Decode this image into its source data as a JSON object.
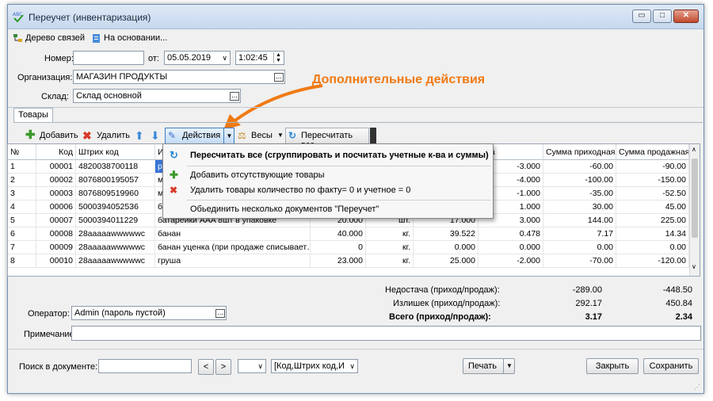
{
  "window": {
    "title": "Переучет (инвентаризация)",
    "minimize": "▭",
    "maximize": "□",
    "close": "✕"
  },
  "links": {
    "tree": "Дерево связей",
    "based_on": "На основании..."
  },
  "header": {
    "number_label": "Номер:",
    "number_value": "",
    "date_label": "от:",
    "date_value": "05.05.2019",
    "time_value": "1:02:45",
    "org_label": "Организация:",
    "org_value": "МАГАЗИН ПРОДУКТЫ",
    "warehouse_label": "Склад:",
    "warehouse_value": "Склад основной"
  },
  "annotation": {
    "text": "Дополнительные действия",
    "color": "#f07a14"
  },
  "tabs": {
    "goods": "Товары"
  },
  "toolbar": {
    "add": "Добавить",
    "delete": "Удалить",
    "actions": "Действия",
    "scales": "Весы",
    "recalc": "Пересчитать все"
  },
  "grid": {
    "columns": [
      "№",
      "Код",
      "Штрих код",
      "Ин",
      "ица",
      "Сумма приходная",
      "Сумма продажная"
    ],
    "rows": [
      {
        "n": "1",
        "code": "00001",
        "barcode": "4820038700118",
        "name": "рис",
        "qty_fact": "",
        "unit": "",
        "price": "",
        "diff": "-3.000",
        "sum_in": "-60.00",
        "sum_sale": "-90.00"
      },
      {
        "n": "2",
        "code": "00002",
        "barcode": "8076800195057",
        "name": "ма",
        "qty_fact": "",
        "unit": "",
        "price": "",
        "diff": "-4.000",
        "sum_in": "-100.00",
        "sum_sale": "-150.00"
      },
      {
        "n": "3",
        "code": "00003",
        "barcode": "8076809519960",
        "name": "ма",
        "qty_fact": "",
        "unit": "",
        "price": "",
        "diff": "-1.000",
        "sum_in": "-35.00",
        "sum_sale": "-52.50"
      },
      {
        "n": "4",
        "code": "00006",
        "barcode": "5000394052536",
        "name": "бат",
        "qty_fact": "",
        "unit": "",
        "price": "",
        "diff": "1.000",
        "sum_in": "30.00",
        "sum_sale": "45.00"
      },
      {
        "n": "5",
        "code": "00007",
        "barcode": "5000394011229",
        "name": "батарейки AAA 8шт в упаковке",
        "qty_fact": "20.000",
        "unit": "шт.",
        "price": "17.000",
        "diff": "3.000",
        "sum_in": "144.00",
        "sum_sale": "225.00"
      },
      {
        "n": "6",
        "code": "00008",
        "barcode": "28aaaaawwwwwc",
        "name": "банан",
        "qty_fact": "40.000",
        "unit": "кг.",
        "price": "39.522",
        "diff": "0.478",
        "sum_in": "7.17",
        "sum_sale": "14.34"
      },
      {
        "n": "7",
        "code": "00009",
        "barcode": "28aaaaawwwwwc",
        "name": "банан уценка (при продаже списывает…",
        "qty_fact": "0",
        "unit": "кг.",
        "price": "0.000",
        "diff": "0.000",
        "sum_in": "0.00",
        "sum_sale": "0.00"
      },
      {
        "n": "8",
        "code": "00010",
        "barcode": "28aaaaawwwwwc",
        "name": "груша",
        "qty_fact": "23.000",
        "unit": "кг.",
        "price": "25.000",
        "diff": "-2.000",
        "sum_in": "-70.00",
        "sum_sale": "-120.00"
      }
    ]
  },
  "menu": {
    "items": [
      "Пересчитать все (сгруппировать и посчитать учетные к-ва и суммы)",
      "Добавить отсутствующие товары",
      "Удалить товары количество по факту= 0  и учетное = 0",
      "Обьединить несколько документов \"Переучет\""
    ]
  },
  "totals": {
    "shortage_label": "Недостача (приход/продаж):",
    "shortage_in": "-289.00",
    "shortage_sale": "-448.50",
    "surplus_label": "Излишек (приход/продаж):",
    "surplus_in": "292.17",
    "surplus_sale": "450.84",
    "total_label": "Всего (приход/продаж):",
    "total_in": "3.17",
    "total_sale": "2.34"
  },
  "footer": {
    "operator_label": "Оператор:",
    "operator_value": "Admin (пароль пустой)",
    "note_label": "Примечание:",
    "note_value": "",
    "search_label": "Поиск в документе:",
    "search_value": "",
    "prev": "<",
    "next": ">",
    "search_field_value": "[Код,Штрих код,И",
    "print": "Печать",
    "close": "Закрыть",
    "save": "Сохранить"
  }
}
